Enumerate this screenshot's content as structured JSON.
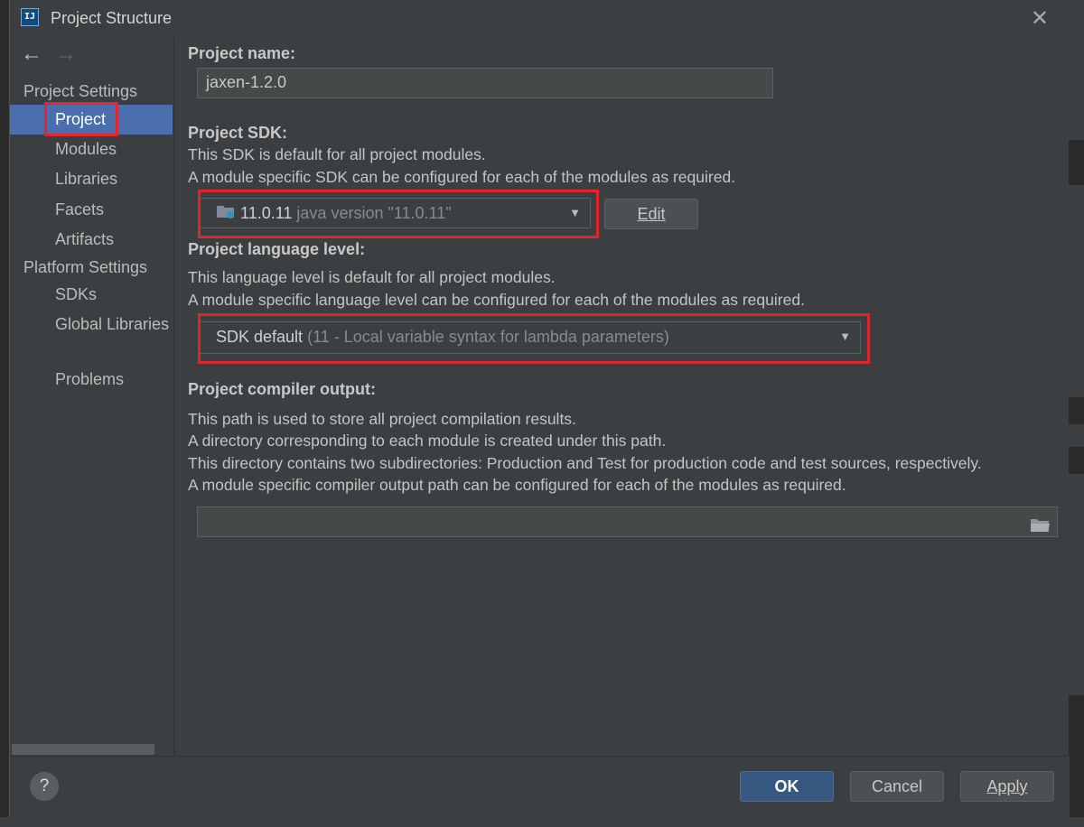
{
  "window": {
    "app_icon_label": "IJ",
    "title": "Project Structure"
  },
  "sidebar": {
    "project_settings_label": "Project Settings",
    "project_settings_items": [
      {
        "label": "Project",
        "selected": true
      },
      {
        "label": "Modules"
      },
      {
        "label": "Libraries"
      },
      {
        "label": "Facets"
      },
      {
        "label": "Artifacts"
      }
    ],
    "platform_settings_label": "Platform Settings",
    "platform_settings_items": [
      {
        "label": "SDKs"
      },
      {
        "label": "Global Libraries"
      }
    ],
    "problems_label": "Problems"
  },
  "main": {
    "project_name": {
      "heading": "Project name:",
      "value": "jaxen-1.2.0"
    },
    "project_sdk": {
      "heading": "Project SDK:",
      "desc1": "This SDK is default for all project modules.",
      "desc2": "A module specific SDK can be configured for each of the modules as required.",
      "selected_version": "11.0.11",
      "selected_detail": "java version \"11.0.11\"",
      "edit_label": "Edit"
    },
    "language_level": {
      "heading": "Project language level:",
      "desc1": "This language level is default for all project modules.",
      "desc2": "A module specific language level can be configured for each of the modules as required.",
      "selected": "SDK default",
      "selected_detail": "(11 - Local variable syntax for lambda parameters)"
    },
    "compiler_output": {
      "heading": "Project compiler output:",
      "desc1": "This path is used to store all project compilation results.",
      "desc2": "A directory corresponding to each module is created under this path.",
      "desc3": "This directory contains two subdirectories: Production and Test for production code and test sources, respectively.",
      "desc4": "A module specific compiler output path can be configured for each of the modules as required.",
      "value": ""
    }
  },
  "footer": {
    "help_label": "?",
    "ok_label": "OK",
    "cancel_label": "Cancel",
    "apply_label": "Apply"
  },
  "colors": {
    "selection": "#4b6eaf",
    "highlight_box": "#e0262a",
    "primary_button": "#365880"
  }
}
